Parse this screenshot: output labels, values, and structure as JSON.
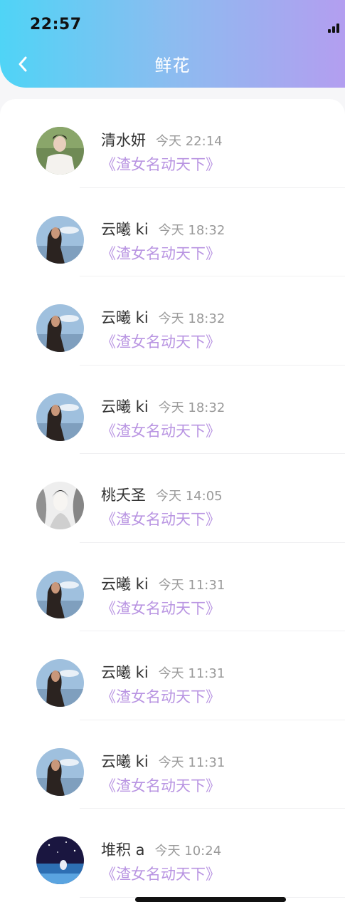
{
  "status_bar": {
    "time": "22:57"
  },
  "header": {
    "title": "鲜花",
    "back_icon": "chevron-left-icon",
    "gradient_colors": [
      "#4fd4f6",
      "#b39ef0"
    ]
  },
  "colors": {
    "book_title": "#b995e2",
    "timestamp": "#9a9a9a"
  },
  "gifts": [
    {
      "user": "清水妍",
      "time": "今天 22:14",
      "book": "《渣女名动天下》",
      "avatar": "avatar-man-white-shirt"
    },
    {
      "user": "云曦 ki",
      "time": "今天 18:32",
      "book": "《渣女名动天下》",
      "avatar": "avatar-woman-sky"
    },
    {
      "user": "云曦 ki",
      "time": "今天 18:32",
      "book": "《渣女名动天下》",
      "avatar": "avatar-woman-sky"
    },
    {
      "user": "云曦 ki",
      "time": "今天 18:32",
      "book": "《渣女名动天下》",
      "avatar": "avatar-woman-sky"
    },
    {
      "user": "桃夭圣",
      "time": "今天 14:05",
      "book": "《渣女名动天下》",
      "avatar": "avatar-ink-portrait"
    },
    {
      "user": "云曦 ki",
      "time": "今天 11:31",
      "book": "《渣女名动天下》",
      "avatar": "avatar-woman-sky"
    },
    {
      "user": "云曦 ki",
      "time": "今天 11:31",
      "book": "《渣女名动天下》",
      "avatar": "avatar-woman-sky"
    },
    {
      "user": "云曦 ki",
      "time": "今天 11:31",
      "book": "《渣女名动天下》",
      "avatar": "avatar-woman-sky"
    },
    {
      "user": "堆积 a",
      "time": "今天 10:24",
      "book": "《渣女名动天下》",
      "avatar": "avatar-night-scene"
    }
  ]
}
